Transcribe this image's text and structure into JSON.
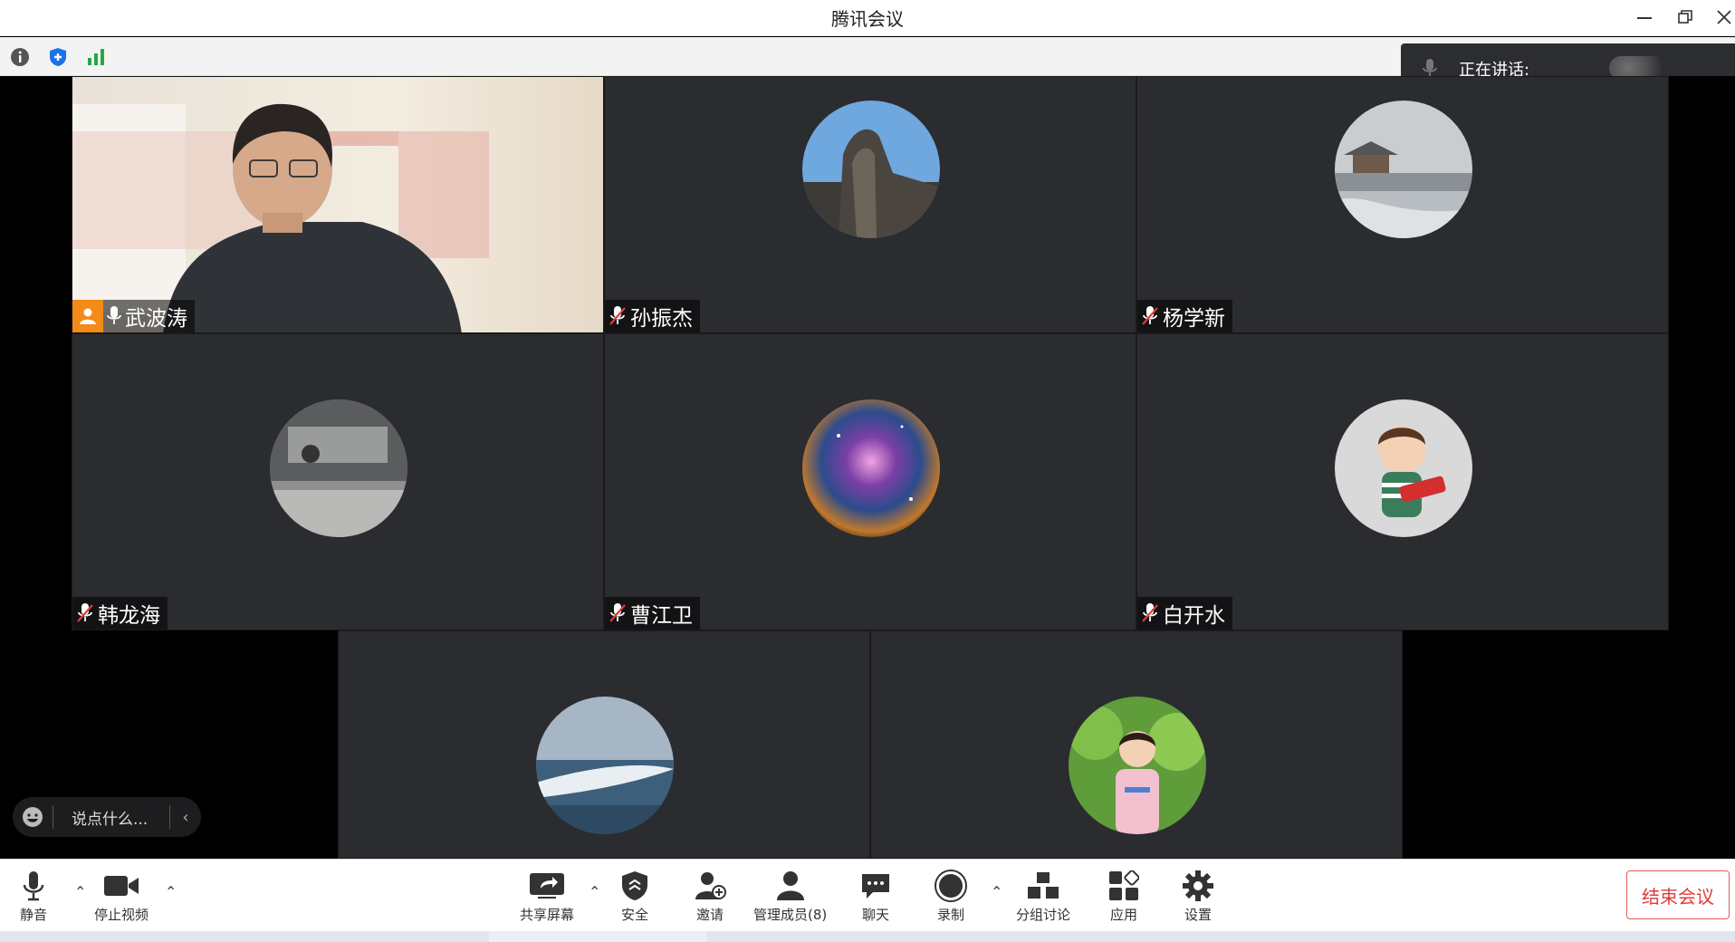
{
  "window": {
    "title": "腾讯会议"
  },
  "infobar": {
    "icons": [
      "info-icon",
      "security-shield-icon",
      "network-signal-icon"
    ]
  },
  "speaking": {
    "label": "正在讲话:"
  },
  "participants": [
    {
      "name": "武波涛",
      "host": true,
      "muted": false,
      "video": true
    },
    {
      "name": "孙振杰",
      "host": false,
      "muted": true,
      "avatar": "mountain-cliff"
    },
    {
      "name": "杨学新",
      "host": false,
      "muted": true,
      "avatar": "snowy-lake-pavilion"
    },
    {
      "name": "韩龙海",
      "host": false,
      "muted": true,
      "avatar": "car-underside"
    },
    {
      "name": "曹江卫",
      "host": false,
      "muted": true,
      "avatar": "nebula"
    },
    {
      "name": "白开水",
      "host": false,
      "muted": true,
      "avatar": "cartoon-boy"
    },
    {
      "name": "",
      "host": false,
      "muted": true,
      "avatar": "sea-wave"
    },
    {
      "name": "",
      "host": false,
      "muted": true,
      "avatar": "child-lotus"
    }
  ],
  "chat": {
    "placeholder": "说点什么..."
  },
  "toolbar": {
    "mute": "静音",
    "stop_video": "停止视频",
    "share_screen": "共享屏幕",
    "security": "安全",
    "invite": "邀请",
    "manage_members": "管理成员(8)",
    "chat": "聊天",
    "record": "录制",
    "breakout": "分组讨论",
    "apps": "应用",
    "settings": "设置",
    "end_meeting": "结束会议"
  },
  "colors": {
    "host_badge": "#f28b17",
    "end_button": "#e03b3b",
    "tile_bg": "#2b2c2f",
    "signal_green": "#27a844",
    "shield_blue": "#1a73e8"
  }
}
